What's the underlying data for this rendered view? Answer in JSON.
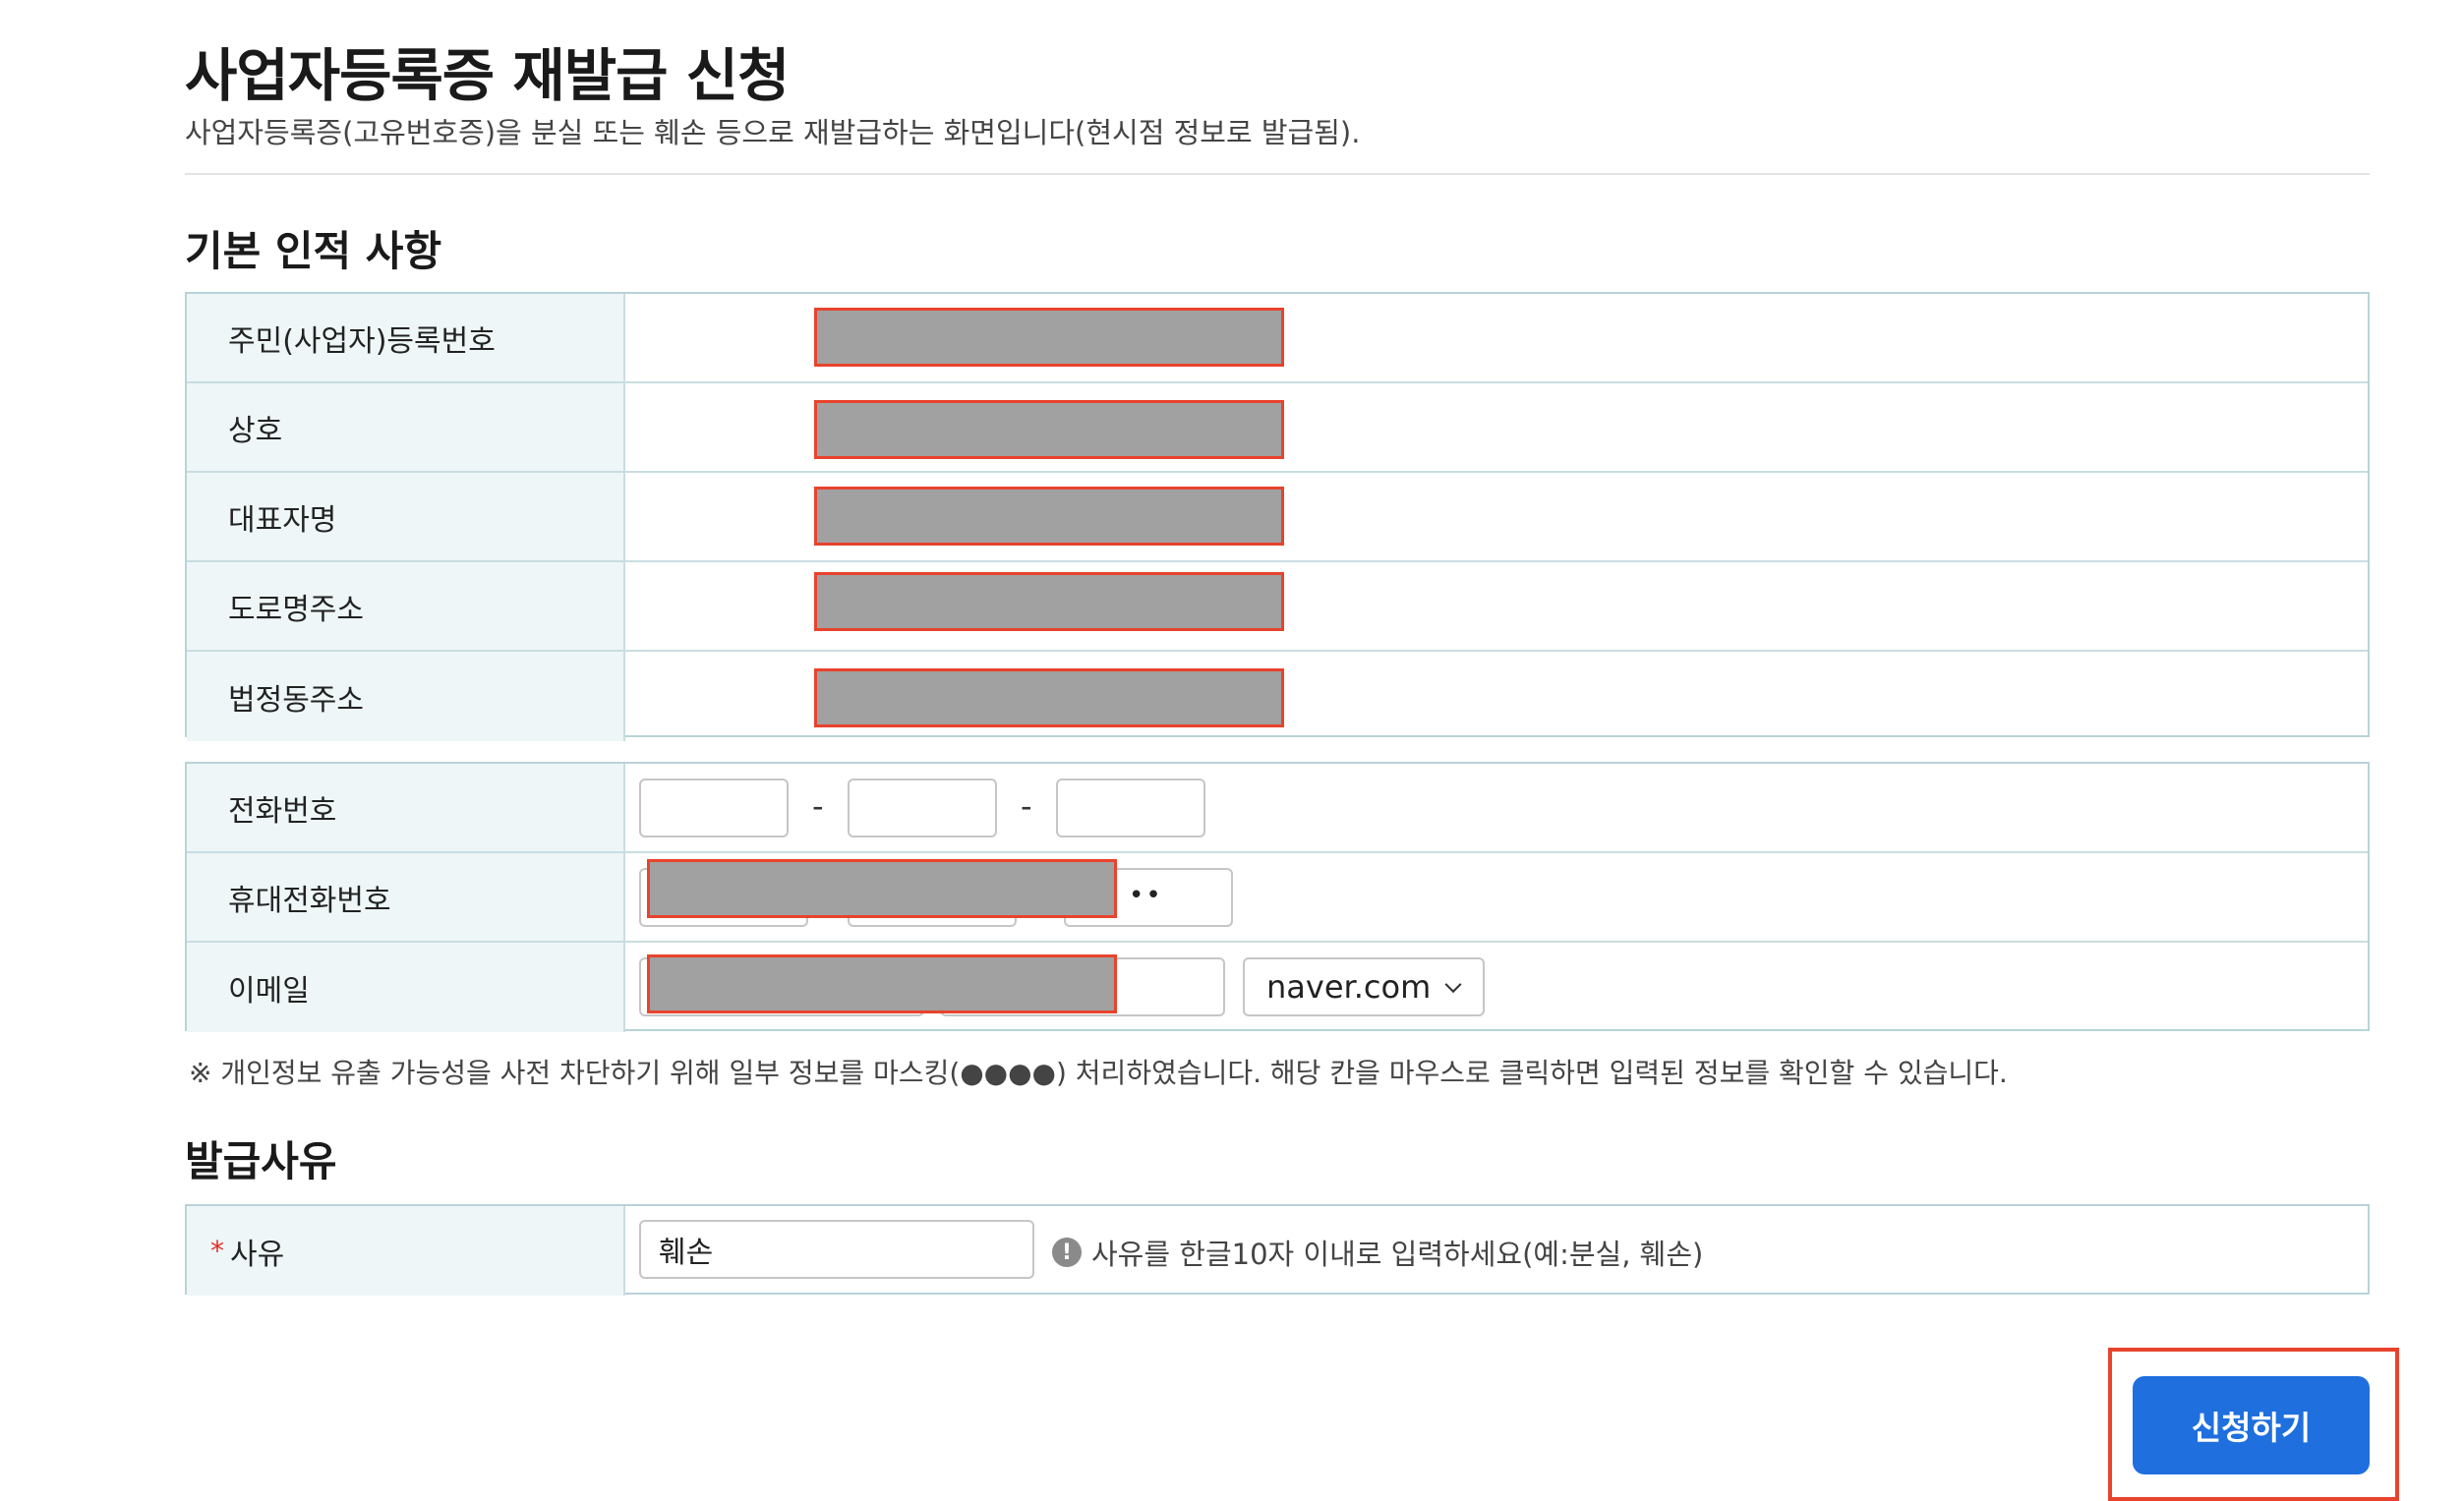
{
  "header": {
    "title": "사업자등록증 재발급 신청",
    "description": "사업자등록증(고유번호증)을 분실 또는 훼손 등으로 재발급하는 화면입니다(현시점 정보로 발급됨)."
  },
  "basic_info": {
    "section_title": "기본 인적 사항",
    "rows": [
      {
        "label": "주민(사업자)등록번호"
      },
      {
        "label": "상호"
      },
      {
        "label": "대표자명"
      },
      {
        "label": "도로명주소"
      },
      {
        "label": "법정동주소"
      }
    ]
  },
  "contact": {
    "phone_label": "전화번호",
    "mobile_label": "휴대전화번호",
    "email_label": "이메일",
    "separator": "-",
    "mobile_masked_tail": "••",
    "email_domain": "naver.com"
  },
  "masking_note": "※ 개인정보 유출 가능성을 사전 차단하기 위해 일부 정보를 마스킹(●●●●) 처리하였습니다. 해당 칸을 마우스로 클릭하면 입력된 정보를 확인할 수 있습니다.",
  "issue_reason": {
    "section_title": "발급사유",
    "required_mark": "*",
    "label": "사유",
    "value": "훼손",
    "hint_icon": "!",
    "hint": "사유를 한글10자 이내로 입력하세요(예:분실, 훼손)"
  },
  "actions": {
    "submit_label": "신청하기"
  },
  "colors": {
    "accent": "#1f6fde",
    "highlight": "#e8432d",
    "mask": "#a1a1a1",
    "label_bg": "#eef6f7",
    "border": "#b9d3d8"
  }
}
